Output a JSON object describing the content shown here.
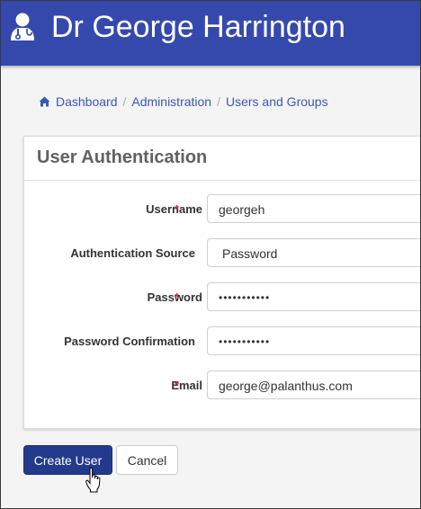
{
  "header": {
    "title": "Dr George Harrington",
    "icon": "user-doctor-icon",
    "color": "#3549ad"
  },
  "breadcrumb": [
    {
      "label": "Dashboard",
      "icon": "home-icon"
    },
    {
      "label": "Administration"
    },
    {
      "label": "Users and Groups"
    }
  ],
  "breadcrumb_separator": "/",
  "panel": {
    "title": "User Authentication",
    "fields": [
      {
        "label": "Username",
        "required": true,
        "value": "georgeh"
      },
      {
        "label": "Authentication Source",
        "required": false,
        "value": "Password"
      },
      {
        "label": "Password",
        "required": true,
        "value": "•••••••••••"
      },
      {
        "label": "Password Confirmation",
        "required": false,
        "value": "•••••••••••"
      },
      {
        "label": "Email",
        "required": true,
        "value": "george@palanthus.com"
      }
    ],
    "required_marker": "*"
  },
  "actions": {
    "create_label": "Create User",
    "cancel_label": "Cancel"
  }
}
